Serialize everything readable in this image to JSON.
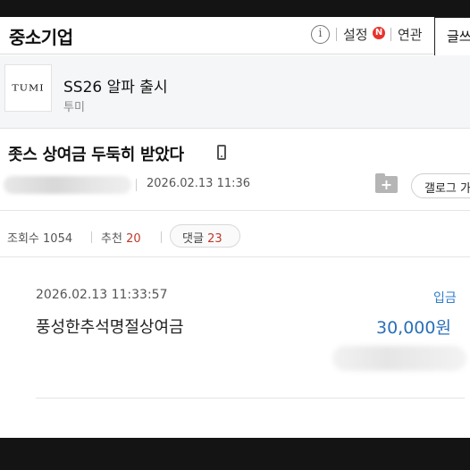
{
  "header": {
    "board_title": "중소기업",
    "info_icon": "info-icon",
    "settings_label": "설정",
    "settings_badge": "N",
    "related_label": "연관",
    "write_label": "글쓰"
  },
  "ad": {
    "logo_text": "TUMI",
    "title": "SS26 알파 출시",
    "brand": "투미"
  },
  "post": {
    "title": "좃스 상여금 두둑히 받았다",
    "device_icon": "mobile-icon",
    "date": "2026.02.13 11:36",
    "folder_add_icon": "folder-plus-icon",
    "gallery_label": "갤로그 가"
  },
  "stats": {
    "views_label": "조회수",
    "views": "1054",
    "recommend_label": "추천",
    "recommend": "20",
    "comments_label": "댓글",
    "comments": "23"
  },
  "transaction": {
    "datetime": "2026.02.13  11:33:57",
    "type": "입금",
    "description": "풍성한추석명절상여금",
    "amount": "30,000원"
  },
  "colors": {
    "accent_blue": "#2a6fb8",
    "badge_red": "#e8332b",
    "count_red": "#c0392b"
  }
}
